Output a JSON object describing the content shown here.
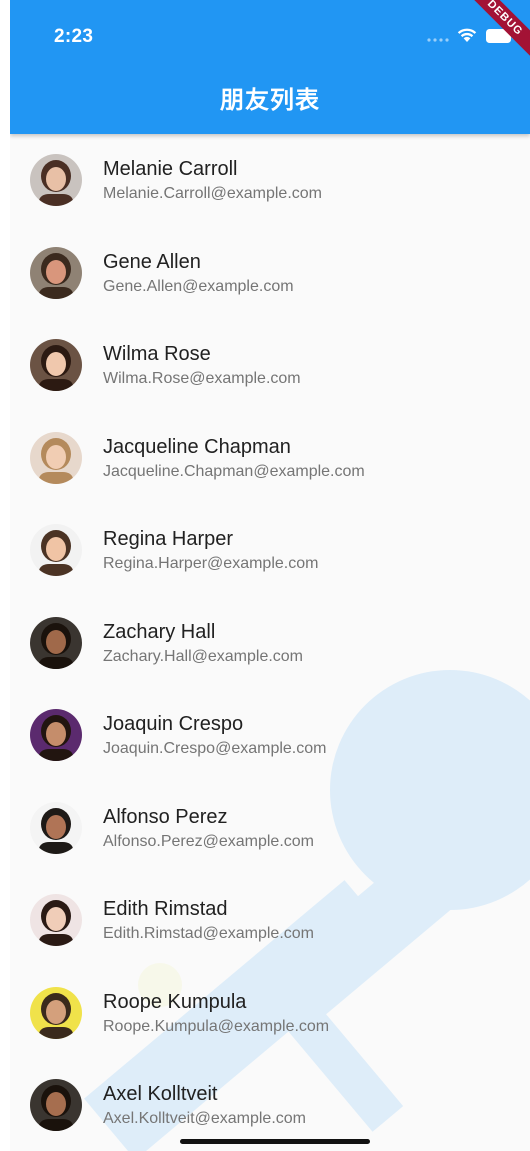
{
  "status_bar": {
    "time": "2:23",
    "debug_label": "DEBUG"
  },
  "app_bar": {
    "title": "朋友列表",
    "color": "#2196f3"
  },
  "friends": [
    {
      "name": "Melanie Carroll",
      "email": "Melanie.Carroll@example.com",
      "avatar_colors": [
        "#c9c3bf",
        "#4a2f24",
        "#e8c0a6"
      ]
    },
    {
      "name": "Gene Allen",
      "email": "Gene.Allen@example.com",
      "avatar_colors": [
        "#8f8274",
        "#3b2a1e",
        "#d9967c"
      ]
    },
    {
      "name": "Wilma Rose",
      "email": "Wilma.Rose@example.com",
      "avatar_colors": [
        "#6b5344",
        "#2c1a12",
        "#f0c8ad"
      ]
    },
    {
      "name": "Jacqueline Chapman",
      "email": "Jacqueline.Chapman@example.com",
      "avatar_colors": [
        "#e7d8cc",
        "#b48a5c",
        "#f1cdb3"
      ]
    },
    {
      "name": "Regina Harper",
      "email": "Regina.Harper@example.com",
      "avatar_colors": [
        "#f2f2f2",
        "#4b3324",
        "#f0c4a5"
      ]
    },
    {
      "name": "Zachary Hall",
      "email": "Zachary.Hall@example.com",
      "avatar_colors": [
        "#3a3530",
        "#1a120c",
        "#a0694a"
      ]
    },
    {
      "name": "Joaquin Crespo",
      "email": "Joaquin.Crespo@example.com",
      "avatar_colors": [
        "#5b2a6e",
        "#221510",
        "#c58d6b"
      ]
    },
    {
      "name": "Alfonso Perez",
      "email": "Alfonso.Perez@example.com",
      "avatar_colors": [
        "#f4f4f4",
        "#1e1a17",
        "#b07456"
      ]
    },
    {
      "name": "Edith Rimstad",
      "email": "Edith.Rimstad@example.com",
      "avatar_colors": [
        "#efe4e4",
        "#2a1a14",
        "#f0cdb8"
      ]
    },
    {
      "name": "Roope Kumpula",
      "email": "Roope.Kumpula@example.com",
      "avatar_colors": [
        "#f0e24a",
        "#3a2a1c",
        "#d4a07c"
      ]
    },
    {
      "name": "Axel Kolltveit",
      "email": "Axel.Kolltveit@example.com",
      "avatar_colors": [
        "#3a3530",
        "#1a120c",
        "#a66e4f"
      ]
    }
  ]
}
